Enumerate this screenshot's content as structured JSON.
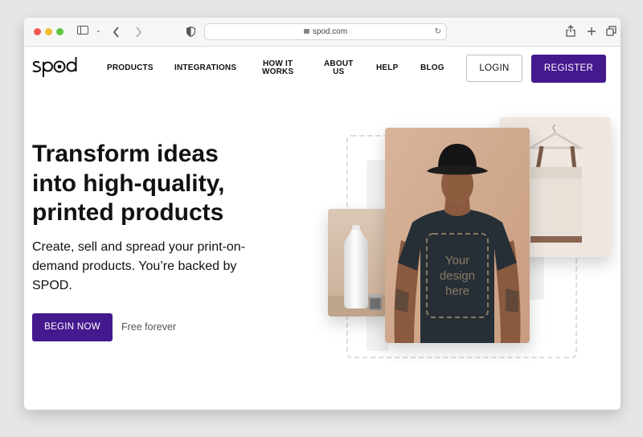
{
  "browser": {
    "url": "spod.com",
    "icons": [
      "sidebar-icon",
      "chevron-down-icon",
      "back-icon",
      "forward-icon",
      "shield-icon",
      "lock-icon",
      "reload-icon",
      "share-icon",
      "new-tab-icon",
      "tabs-icon"
    ]
  },
  "nav": {
    "logo": "spod",
    "links": [
      {
        "l1": "PRODUCTS",
        "l2": ""
      },
      {
        "l1": "INTEGRATIONS",
        "l2": ""
      },
      {
        "l1": "HOW IT",
        "l2": "WORKS"
      },
      {
        "l1": "ABOUT",
        "l2": "US"
      },
      {
        "l1": "HELP",
        "l2": ""
      },
      {
        "l1": "BLOG",
        "l2": ""
      }
    ],
    "login": "LOGIN",
    "register": "REGISTER"
  },
  "hero": {
    "headline_lines": [
      "Transform ideas",
      "into high-quality,",
      "printed products"
    ],
    "subhead_lines": [
      "Create, sell and spread your print-on-",
      "demand products. You’re backed by",
      "SPOD."
    ],
    "cta": "BEGIN NOW",
    "cta_note": "Free forever",
    "shirt_text": [
      "Your",
      "design",
      "here"
    ]
  },
  "colors": {
    "brand": "#45198e",
    "page_bg": "#e6e6e6"
  }
}
